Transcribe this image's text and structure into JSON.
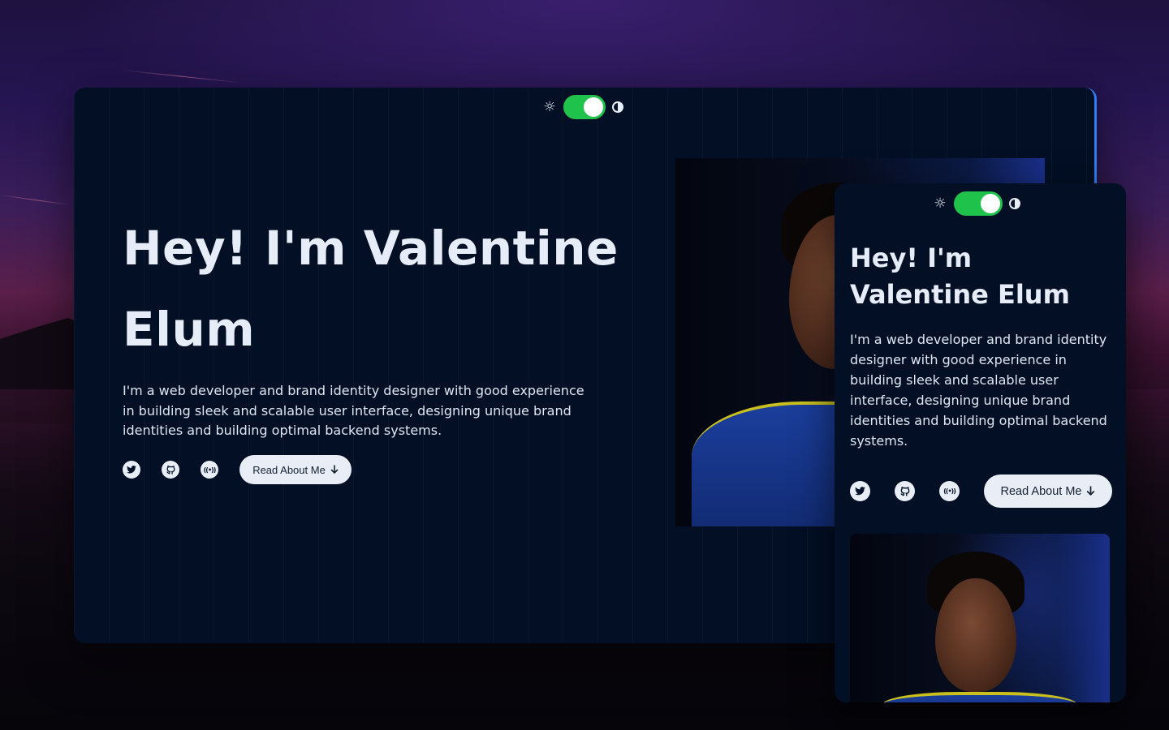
{
  "theme": {
    "accent": "#1fc24a",
    "card_background": "#020f24",
    "text": "#e6edf8",
    "button_background": "#e9eef6"
  },
  "desktop": {
    "toggle": {
      "light_icon": "sun-icon",
      "dark_icon": "contrast-icon",
      "state": "on"
    },
    "title": "Hey! I'm Valentine Elum",
    "description": "I'm a web developer and brand identity designer with good experience in building sleek and scalable user interface, designing unique brand identities and building optimal backend systems.",
    "socials": [
      "twitter-icon",
      "github-icon",
      "broadcast-icon"
    ],
    "read_button": {
      "label": "Read About Me",
      "icon": "arrow-down-icon"
    }
  },
  "mobile": {
    "toggle": {
      "light_icon": "sun-icon",
      "dark_icon": "contrast-icon",
      "state": "on"
    },
    "title": "Hey! I'm Valentine Elum",
    "description": "I'm a web developer and brand identity designer with good experience in building sleek and scalable user interface, designing unique brand identities and building optimal backend systems.",
    "socials": [
      "twitter-icon",
      "github-icon",
      "broadcast-icon"
    ],
    "read_button": {
      "label": "Read About Me",
      "icon": "arrow-down-icon"
    }
  }
}
